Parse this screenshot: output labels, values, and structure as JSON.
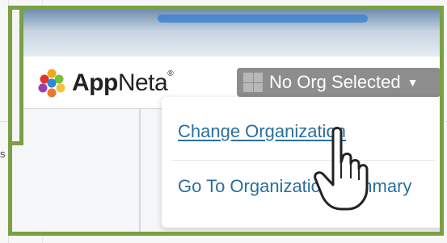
{
  "background": {
    "left_text": "s"
  },
  "header": {
    "brand_bold": "App",
    "brand_rest": "Neta",
    "trademark": "®"
  },
  "org_selector": {
    "label": "No Org Selected",
    "icon": "org-squares-icon",
    "caret_icon": "caret-down-icon"
  },
  "dropdown": {
    "items": [
      {
        "label": "Change Organization"
      },
      {
        "label": "Go To Organization Summary"
      }
    ]
  },
  "cursor": {
    "icon": "hand-pointer-icon"
  },
  "colors": {
    "frame_green": "#7aa043",
    "link_blue": "#2a6f9b",
    "org_button_gray": "#8d8d8d"
  }
}
